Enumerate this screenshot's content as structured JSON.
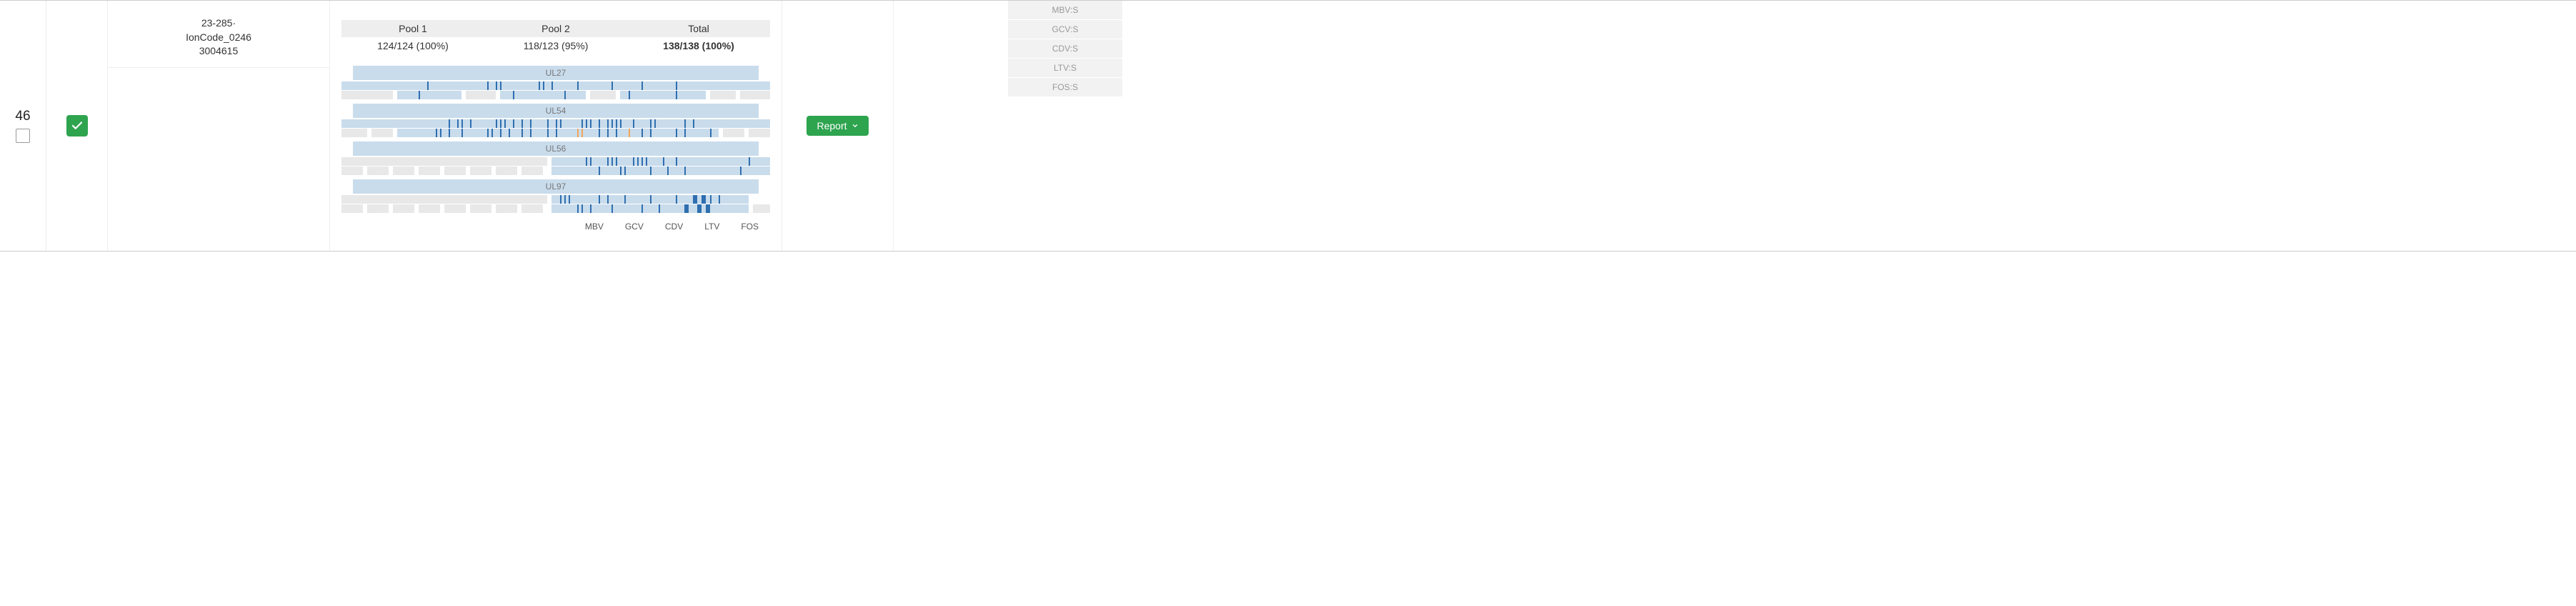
{
  "row": {
    "number": "46",
    "checked": false,
    "status_ok": true,
    "sample_lines": [
      "23-285·",
      "IonCode_0246",
      "3004615"
    ]
  },
  "pools": {
    "cols": [
      {
        "header": "Pool 1",
        "value": "124/124 (100%)"
      },
      {
        "header": "Pool 2",
        "value": "118/123 (95%)"
      },
      {
        "header": "Total",
        "value": "138/138 (100%)",
        "total": true
      }
    ]
  },
  "genes": [
    {
      "name": "UL27",
      "strips": [
        {
          "segs": [
            {
              "p": 0,
              "w": 100,
              "cls": "bg-l"
            }
          ],
          "bars": [
            {
              "p": 20
            },
            {
              "p": 34
            },
            {
              "p": 36
            },
            {
              "p": 37
            },
            {
              "p": 46
            },
            {
              "p": 47
            },
            {
              "p": 49
            },
            {
              "p": 55
            },
            {
              "p": 63
            },
            {
              "p": 70
            },
            {
              "p": 78
            }
          ]
        },
        {
          "segs": [
            {
              "p": 0,
              "w": 12,
              "cls": "bg-g"
            },
            {
              "p": 13,
              "w": 15,
              "cls": "bg-l"
            },
            {
              "p": 29,
              "w": 7,
              "cls": "bg-g"
            },
            {
              "p": 37,
              "w": 20,
              "cls": "bg-l"
            },
            {
              "p": 58,
              "w": 6,
              "cls": "bg-g"
            },
            {
              "p": 65,
              "w": 20,
              "cls": "bg-l"
            },
            {
              "p": 86,
              "w": 6,
              "cls": "bg-g"
            },
            {
              "p": 93,
              "w": 7,
              "cls": "bg-g"
            }
          ],
          "bars": [
            {
              "p": 18
            },
            {
              "p": 40
            },
            {
              "p": 52
            },
            {
              "p": 67
            },
            {
              "p": 78
            }
          ]
        }
      ]
    },
    {
      "name": "UL54",
      "strips": [
        {
          "segs": [
            {
              "p": 0,
              "w": 100,
              "cls": "bg-l"
            }
          ],
          "bars": [
            {
              "p": 25
            },
            {
              "p": 27
            },
            {
              "p": 28
            },
            {
              "p": 30
            },
            {
              "p": 36
            },
            {
              "p": 37
            },
            {
              "p": 38
            },
            {
              "p": 40
            },
            {
              "p": 42
            },
            {
              "p": 44
            },
            {
              "p": 48
            },
            {
              "p": 50
            },
            {
              "p": 51
            },
            {
              "p": 56
            },
            {
              "p": 57
            },
            {
              "p": 58
            },
            {
              "p": 60
            },
            {
              "p": 62
            },
            {
              "p": 63
            },
            {
              "p": 64
            },
            {
              "p": 65
            },
            {
              "p": 68
            },
            {
              "p": 72
            },
            {
              "p": 73
            },
            {
              "p": 80
            },
            {
              "p": 82
            }
          ]
        },
        {
          "segs": [
            {
              "p": 0,
              "w": 6,
              "cls": "bg-g"
            },
            {
              "p": 7,
              "w": 5,
              "cls": "bg-g"
            },
            {
              "p": 13,
              "w": 75,
              "cls": "bg-l"
            },
            {
              "p": 89,
              "w": 5,
              "cls": "bg-g"
            },
            {
              "p": 95,
              "w": 5,
              "cls": "bg-g"
            }
          ],
          "bars": [
            {
              "p": 22
            },
            {
              "p": 23
            },
            {
              "p": 25
            },
            {
              "p": 28
            },
            {
              "p": 34
            },
            {
              "p": 35
            },
            {
              "p": 37
            },
            {
              "p": 39
            },
            {
              "p": 42
            },
            {
              "p": 44
            },
            {
              "p": 48
            },
            {
              "p": 50
            },
            {
              "p": 55,
              "cls": "o"
            },
            {
              "p": 56,
              "cls": "o"
            },
            {
              "p": 60
            },
            {
              "p": 62
            },
            {
              "p": 64
            },
            {
              "p": 67,
              "cls": "o"
            },
            {
              "p": 70
            },
            {
              "p": 72
            },
            {
              "p": 78
            },
            {
              "p": 80
            },
            {
              "p": 86
            }
          ]
        }
      ]
    },
    {
      "name": "UL56",
      "strips": [
        {
          "segs": [
            {
              "p": 0,
              "w": 48,
              "cls": "bg-g"
            },
            {
              "p": 49,
              "w": 51,
              "cls": "bg-l"
            }
          ],
          "bars": [
            {
              "p": 57
            },
            {
              "p": 58
            },
            {
              "p": 62
            },
            {
              "p": 63
            },
            {
              "p": 64
            },
            {
              "p": 68
            },
            {
              "p": 69
            },
            {
              "p": 70
            },
            {
              "p": 71
            },
            {
              "p": 75
            },
            {
              "p": 78
            },
            {
              "p": 95
            }
          ]
        },
        {
          "segs": [
            {
              "p": 0,
              "w": 5,
              "cls": "bg-g"
            },
            {
              "p": 6,
              "w": 5,
              "cls": "bg-g"
            },
            {
              "p": 12,
              "w": 5,
              "cls": "bg-g"
            },
            {
              "p": 18,
              "w": 5,
              "cls": "bg-g"
            },
            {
              "p": 24,
              "w": 5,
              "cls": "bg-g"
            },
            {
              "p": 30,
              "w": 5,
              "cls": "bg-g"
            },
            {
              "p": 36,
              "w": 5,
              "cls": "bg-g"
            },
            {
              "p": 42,
              "w": 5,
              "cls": "bg-g"
            },
            {
              "p": 49,
              "w": 51,
              "cls": "bg-l"
            }
          ],
          "bars": [
            {
              "p": 60
            },
            {
              "p": 65
            },
            {
              "p": 66
            },
            {
              "p": 72
            },
            {
              "p": 76
            },
            {
              "p": 80
            },
            {
              "p": 93
            }
          ]
        }
      ]
    },
    {
      "name": "UL97",
      "strips": [
        {
          "segs": [
            {
              "p": 0,
              "w": 48,
              "cls": "bg-g"
            },
            {
              "p": 49,
              "w": 46,
              "cls": "bg-l"
            }
          ],
          "bars": [
            {
              "p": 51
            },
            {
              "p": 52
            },
            {
              "p": 53
            },
            {
              "p": 60
            },
            {
              "p": 62
            },
            {
              "p": 66
            },
            {
              "p": 72
            },
            {
              "p": 78
            },
            {
              "p": 82,
              "cls": "w"
            },
            {
              "p": 84,
              "cls": "w"
            },
            {
              "p": 86
            },
            {
              "p": 88
            }
          ]
        },
        {
          "segs": [
            {
              "p": 0,
              "w": 5,
              "cls": "bg-g"
            },
            {
              "p": 6,
              "w": 5,
              "cls": "bg-g"
            },
            {
              "p": 12,
              "w": 5,
              "cls": "bg-g"
            },
            {
              "p": 18,
              "w": 5,
              "cls": "bg-g"
            },
            {
              "p": 24,
              "w": 5,
              "cls": "bg-g"
            },
            {
              "p": 30,
              "w": 5,
              "cls": "bg-g"
            },
            {
              "p": 36,
              "w": 5,
              "cls": "bg-g"
            },
            {
              "p": 42,
              "w": 5,
              "cls": "bg-g"
            },
            {
              "p": 49,
              "w": 46,
              "cls": "bg-l"
            },
            {
              "p": 96,
              "w": 4,
              "cls": "bg-g"
            }
          ],
          "bars": [
            {
              "p": 55
            },
            {
              "p": 56
            },
            {
              "p": 58
            },
            {
              "p": 63
            },
            {
              "p": 70
            },
            {
              "p": 74
            },
            {
              "p": 80,
              "cls": "w"
            },
            {
              "p": 83,
              "cls": "w"
            },
            {
              "p": 85,
              "cls": "w"
            }
          ]
        }
      ]
    }
  ],
  "drugs": [
    "MBV",
    "GCV",
    "CDV",
    "LTV",
    "FOS"
  ],
  "actions": {
    "report_label": "Report"
  },
  "badges": [
    "MBV:S",
    "GCV:S",
    "CDV:S",
    "LTV:S",
    "FOS:S"
  ]
}
